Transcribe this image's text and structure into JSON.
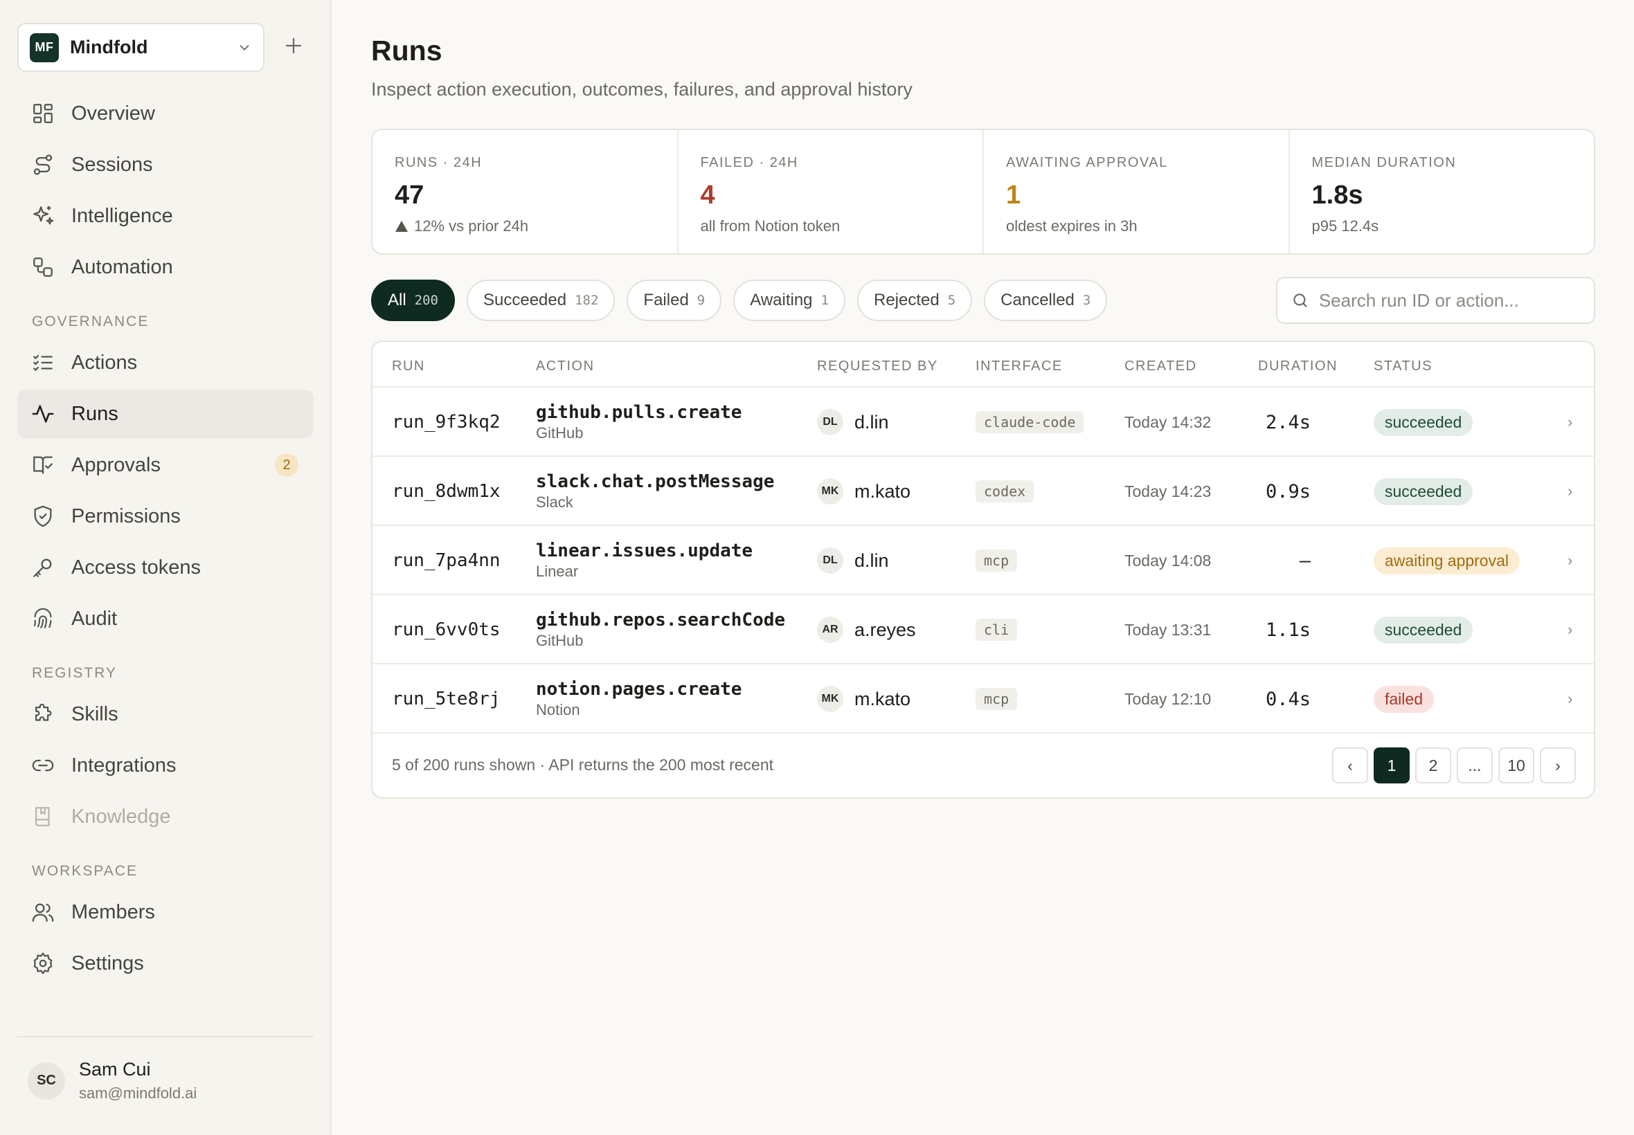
{
  "workspace": {
    "initials": "MF",
    "name": "Mindfold"
  },
  "nav": {
    "main": [
      {
        "id": "overview",
        "label": "Overview",
        "icon": "layout-grid-icon"
      },
      {
        "id": "sessions",
        "label": "Sessions",
        "icon": "sessions-icon"
      },
      {
        "id": "intelligence",
        "label": "Intelligence",
        "icon": "sparkles-icon"
      },
      {
        "id": "automation",
        "label": "Automation",
        "icon": "workflow-icon"
      }
    ],
    "governance_title": "GOVERNANCE",
    "governance": [
      {
        "id": "actions",
        "label": "Actions",
        "icon": "list-checks-icon"
      },
      {
        "id": "runs",
        "label": "Runs",
        "icon": "activity-icon",
        "active": true
      },
      {
        "id": "approvals",
        "label": "Approvals",
        "icon": "book-check-icon",
        "badge": "2"
      },
      {
        "id": "permissions",
        "label": "Permissions",
        "icon": "shield-check-icon"
      },
      {
        "id": "access-tokens",
        "label": "Access tokens",
        "icon": "key-icon"
      },
      {
        "id": "audit",
        "label": "Audit",
        "icon": "fingerprint-icon"
      }
    ],
    "registry_title": "REGISTRY",
    "registry": [
      {
        "id": "skills",
        "label": "Skills",
        "icon": "puzzle-icon"
      },
      {
        "id": "integrations",
        "label": "Integrations",
        "icon": "link-icon"
      },
      {
        "id": "knowledge",
        "label": "Knowledge",
        "icon": "book-icon",
        "disabled": true
      }
    ],
    "workspace_title": "WORKSPACE",
    "workspace": [
      {
        "id": "members",
        "label": "Members",
        "icon": "users-icon"
      },
      {
        "id": "settings",
        "label": "Settings",
        "icon": "gear-icon"
      }
    ]
  },
  "user": {
    "initials": "SC",
    "name": "Sam Cui",
    "email": "sam@mindfold.ai"
  },
  "page": {
    "title": "Runs",
    "subtitle": "Inspect action execution, outcomes, failures, and approval history"
  },
  "stats": [
    {
      "label": "RUNS · 24H",
      "value": "47",
      "sub": "12% vs prior 24h",
      "tone": "default",
      "trend": "up"
    },
    {
      "label": "FAILED · 24H",
      "value": "4",
      "sub": "all from Notion token",
      "tone": "red"
    },
    {
      "label": "AWAITING APPROVAL",
      "value": "1",
      "sub": "oldest expires in 3h",
      "tone": "amber"
    },
    {
      "label": "MEDIAN DURATION",
      "value": "1.8s",
      "sub": "p95 12.4s",
      "tone": "default"
    }
  ],
  "filters": [
    {
      "label": "All",
      "count": "200",
      "active": true
    },
    {
      "label": "Succeeded",
      "count": "182"
    },
    {
      "label": "Failed",
      "count": "9"
    },
    {
      "label": "Awaiting",
      "count": "1"
    },
    {
      "label": "Rejected",
      "count": "5"
    },
    {
      "label": "Cancelled",
      "count": "3"
    }
  ],
  "search": {
    "placeholder": "Search run ID or action..."
  },
  "table": {
    "columns": [
      "RUN",
      "ACTION",
      "REQUESTED BY",
      "INTERFACE",
      "CREATED",
      "DURATION",
      "STATUS"
    ],
    "rows": [
      {
        "run": "run_9f3kq2",
        "action": "github.pulls.create",
        "provider": "GitHub",
        "initials": "DL",
        "user": "d.lin",
        "interface": "claude-code",
        "created": "Today 14:32",
        "duration": "2.4s",
        "status": "succeeded",
        "status_kind": "succeeded"
      },
      {
        "run": "run_8dwm1x",
        "action": "slack.chat.postMessage",
        "provider": "Slack",
        "initials": "MK",
        "user": "m.kato",
        "interface": "codex",
        "created": "Today 14:23",
        "duration": "0.9s",
        "status": "succeeded",
        "status_kind": "succeeded"
      },
      {
        "run": "run_7pa4nn",
        "action": "linear.issues.update",
        "provider": "Linear",
        "initials": "DL",
        "user": "d.lin",
        "interface": "mcp",
        "created": "Today 14:08",
        "duration": "—",
        "status": "awaiting approval",
        "status_kind": "awaiting"
      },
      {
        "run": "run_6vv0ts",
        "action": "github.repos.searchCode",
        "provider": "GitHub",
        "initials": "AR",
        "user": "a.reyes",
        "interface": "cli",
        "created": "Today 13:31",
        "duration": "1.1s",
        "status": "succeeded",
        "status_kind": "succeeded"
      },
      {
        "run": "run_5te8rj",
        "action": "notion.pages.create",
        "provider": "Notion",
        "initials": "MK",
        "user": "m.kato",
        "interface": "mcp",
        "created": "Today 12:10",
        "duration": "0.4s",
        "status": "failed",
        "status_kind": "failed"
      }
    ],
    "footer_note": "5 of 200 runs shown · API returns the 200 most recent"
  },
  "pagination": {
    "prev": "‹",
    "pages": [
      {
        "label": "1",
        "active": true
      },
      {
        "label": "2"
      },
      {
        "label": "..."
      },
      {
        "label": "10"
      }
    ],
    "next": "›"
  },
  "colors": {
    "brand": "#0f2a21",
    "failed": "#b03a2e",
    "awaiting": "#c08418",
    "succeeded_bg": "#e3ede7"
  }
}
